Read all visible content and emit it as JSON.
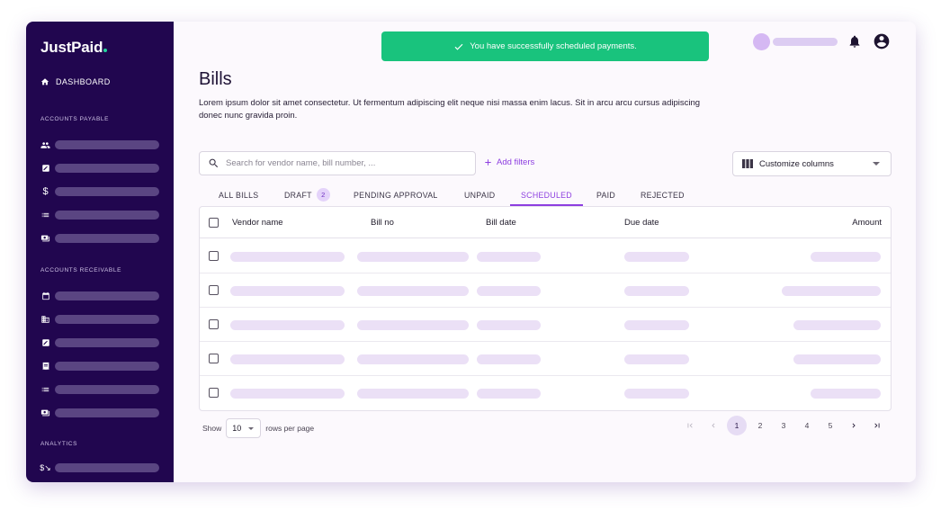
{
  "sidebar": {
    "logo": "JustPaid",
    "dashboard_label": "DASHBOARD",
    "sections": [
      {
        "label": "ACCOUNTS PAYABLE",
        "items": [
          {
            "icon": "users-icon"
          },
          {
            "icon": "edit-icon"
          },
          {
            "icon": "dollar-icon"
          },
          {
            "icon": "list-icon"
          },
          {
            "icon": "money-icon"
          }
        ]
      },
      {
        "label": "ACCOUNTS RECEIVABLE",
        "items": [
          {
            "icon": "calendar-icon"
          },
          {
            "icon": "building-icon"
          },
          {
            "icon": "edit-icon"
          },
          {
            "icon": "receipt-icon"
          },
          {
            "icon": "list-icon"
          },
          {
            "icon": "money-icon"
          }
        ]
      },
      {
        "label": "ANALYTICS",
        "items": [
          {
            "icon": "analytics-icon"
          }
        ]
      }
    ]
  },
  "toast": {
    "message": "You have successfully scheduled payments."
  },
  "page": {
    "title": "Bills",
    "description": "Lorem ipsum dolor sit amet consectetur. Ut fermentum adipiscing elit neque nisi massa enim lacus. Sit in arcu arcu cursus adipiscing donec nunc gravida proin."
  },
  "toolbar": {
    "search_placeholder": "Search for vendor name, bill number, ...",
    "add_filters_label": "Add filters",
    "customize_columns_label": "Customize columns"
  },
  "tabs": [
    {
      "label": "ALL BILLS"
    },
    {
      "label": "DRAFT",
      "badge": "2"
    },
    {
      "label": "PENDING APPROVAL"
    },
    {
      "label": "UNPAID"
    },
    {
      "label": "SCHEDULED",
      "active": true
    },
    {
      "label": "PAID"
    },
    {
      "label": "REJECTED"
    }
  ],
  "table": {
    "columns": [
      "Vendor name",
      "Bill no",
      "Bill date",
      "Due date",
      "Amount"
    ],
    "row_count": 5
  },
  "pagination": {
    "show_label": "Show",
    "rows_value": "10",
    "rows_per_page_label": "rows per page",
    "pages": [
      "1",
      "2",
      "3",
      "4",
      "5"
    ],
    "current_page": "1"
  },
  "colors": {
    "sidebar_bg": "#21064f",
    "accent": "#8d3ee0",
    "success": "#19c37d",
    "skeleton": "#ebe0f6"
  }
}
